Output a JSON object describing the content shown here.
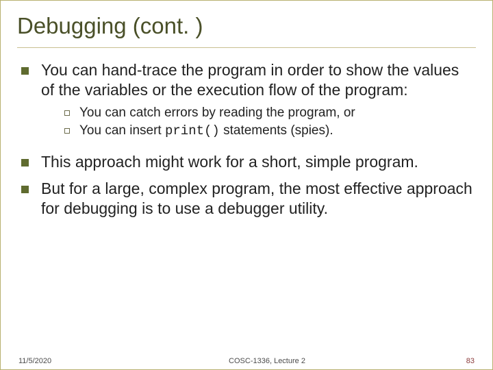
{
  "title": "Debugging (cont. )",
  "bullets": {
    "b1": "You can hand-trace the program in order to show the values of the variables or the execution flow of the program:",
    "b1a": "You can catch errors by reading the program, or",
    "b1b_pre": "You can insert ",
    "b1b_code": "print()",
    "b1b_post": " statements (spies).",
    "b2": "This approach might work for a short, simple program.",
    "b3": "But for a large, complex program, the most effective approach for debugging is to use a debugger utility."
  },
  "footer": {
    "date": "11/5/2020",
    "course": "COSC-1336, Lecture 2",
    "page": "83"
  }
}
